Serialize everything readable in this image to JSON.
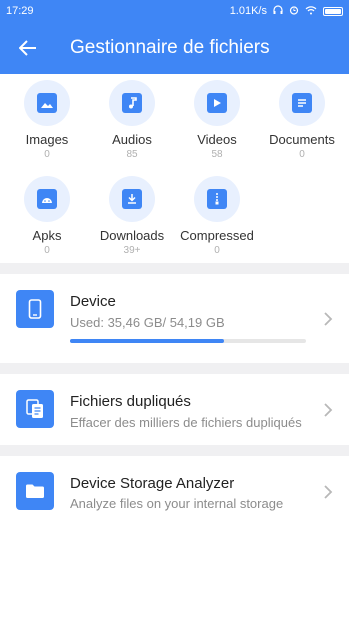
{
  "status_bar": {
    "time": "17:29",
    "speed": "1.01K/s"
  },
  "app_bar": {
    "title": "Gestionnaire de fichiers"
  },
  "categories": [
    {
      "label": "Images",
      "count": "0",
      "icon": "image-icon"
    },
    {
      "label": "Audios",
      "count": "85",
      "icon": "music-note-icon"
    },
    {
      "label": "Videos",
      "count": "58",
      "icon": "play-icon"
    },
    {
      "label": "Documents",
      "count": "0",
      "icon": "document-icon"
    },
    {
      "label": "Apks",
      "count": "0",
      "icon": "android-icon"
    },
    {
      "label": "Downloads",
      "count": "39+",
      "icon": "download-icon"
    },
    {
      "label": "Compressed",
      "count": "0",
      "icon": "zip-icon"
    }
  ],
  "device": {
    "name": "Device",
    "usage": "Used: 35,46 GB/ 54,19 GB",
    "used_fraction": 0.654
  },
  "duplicates": {
    "name": "Fichiers dupliqués",
    "description": "Effacer des milliers de fichiers dupliqués"
  },
  "analyzer": {
    "name": "Device Storage Analyzer",
    "description": "Analyze files on your internal storage"
  },
  "colors": {
    "accent": "#3f86f5",
    "icon_bg": "#e8f0fe",
    "divider": "#f0f0f2"
  }
}
